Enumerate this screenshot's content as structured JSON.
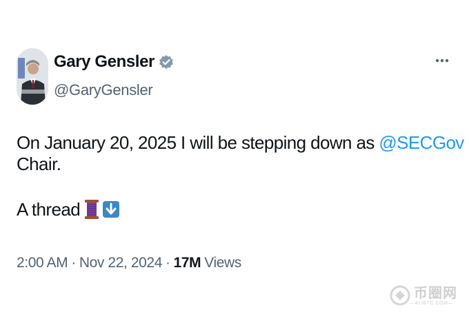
{
  "tweet": {
    "author": {
      "display_name": "Gary Gensler",
      "handle": "@GaryGensler",
      "verified": true
    },
    "text_before_mention": "On January 20, 2025 I will be stepping down as ",
    "mention": "@SECGov",
    "text_after_mention": " Chair.",
    "thread_text": "A thread",
    "emojis": [
      "thread-spool-emoji",
      "down-arrow-emoji"
    ],
    "meta": {
      "time": "2:00 AM",
      "separator": "·",
      "date": "Nov 22, 2024",
      "views_count": "17M",
      "views_label": "Views"
    }
  },
  "colors": {
    "text": "#0f1419",
    "secondary": "#536471",
    "link": "#1d9bf0",
    "verified_badge": "#829aab"
  },
  "watermark": {
    "title": "币圈网",
    "subtitle": "—ALIBTC.COM—"
  }
}
